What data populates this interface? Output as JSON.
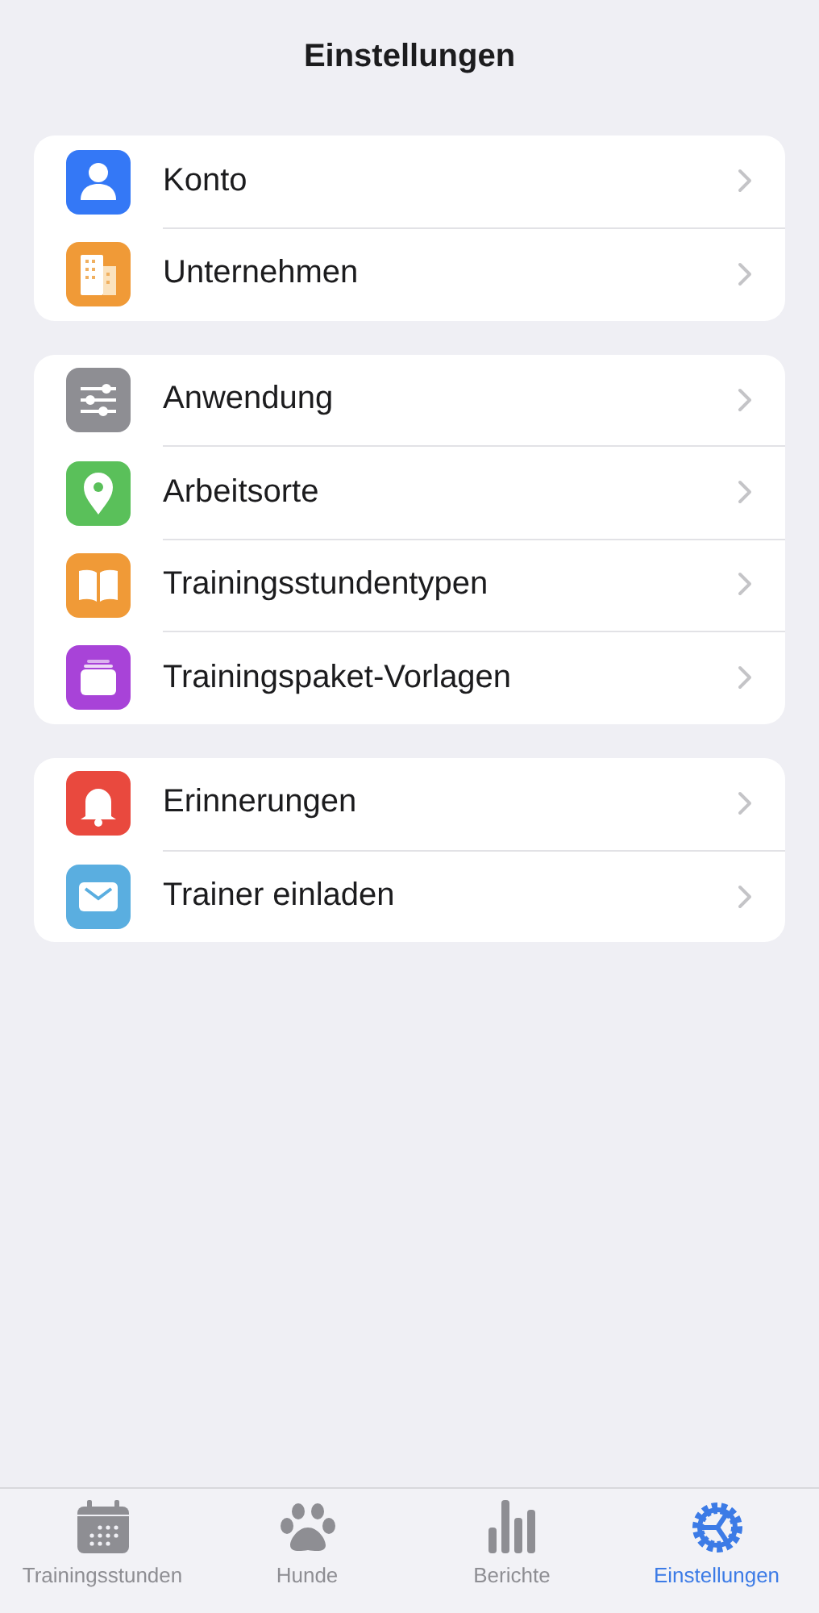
{
  "header": {
    "title": "Einstellungen"
  },
  "groups": [
    {
      "items": [
        {
          "label": "Konto",
          "kind": "person",
          "color": "#3478f6"
        },
        {
          "label": "Unternehmen",
          "kind": "building",
          "color": "#f09a37"
        }
      ]
    },
    {
      "items": [
        {
          "label": "Anwendung",
          "kind": "sliders",
          "color": "#8e8e93"
        },
        {
          "label": "Arbeitsorte",
          "kind": "pin",
          "color": "#5ac05a"
        },
        {
          "label": "Trainingsstundentypen",
          "kind": "book",
          "color": "#f09a37"
        },
        {
          "label": "Trainingspaket-Vorlagen",
          "kind": "stack",
          "color": "#a843d8"
        }
      ]
    },
    {
      "items": [
        {
          "label": "Erinnerungen",
          "kind": "bell",
          "color": "#e9493e"
        },
        {
          "label": "Trainer einladen",
          "kind": "mail",
          "color": "#5aaee0"
        }
      ]
    }
  ],
  "tabs": [
    {
      "label": "Trainingsstunden",
      "kind": "calendar",
      "selected": false
    },
    {
      "label": "Hunde",
      "kind": "paw",
      "selected": false
    },
    {
      "label": "Berichte",
      "kind": "chart",
      "selected": false
    },
    {
      "label": "Einstellungen",
      "kind": "gear",
      "selected": true
    }
  ]
}
